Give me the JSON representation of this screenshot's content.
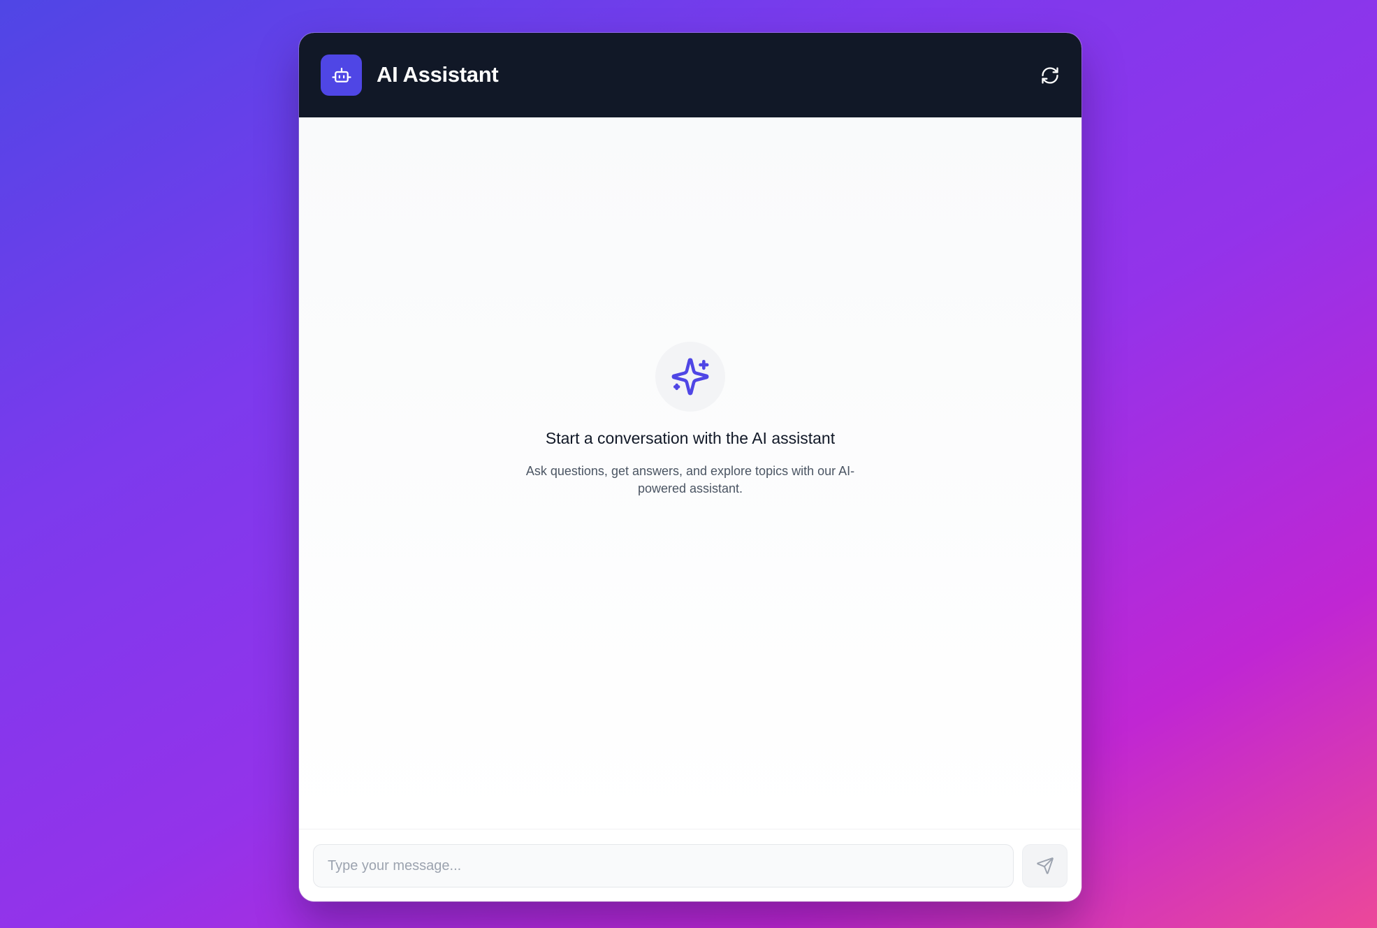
{
  "header": {
    "title": "AI Assistant",
    "logo_icon": "robot-icon",
    "refresh_icon": "refresh-icon"
  },
  "empty_state": {
    "icon": "sparkles-icon",
    "title": "Start a conversation with the AI assistant",
    "subtitle": "Ask questions, get answers, and explore topics with our AI-powered assistant."
  },
  "composer": {
    "placeholder": "Type your message...",
    "value": "",
    "send_icon": "send-icon"
  },
  "colors": {
    "accent": "#4f46e5",
    "header_bg": "#111827",
    "background_gradient_start": "#4f46e5",
    "background_gradient_end": "#ec4899"
  }
}
